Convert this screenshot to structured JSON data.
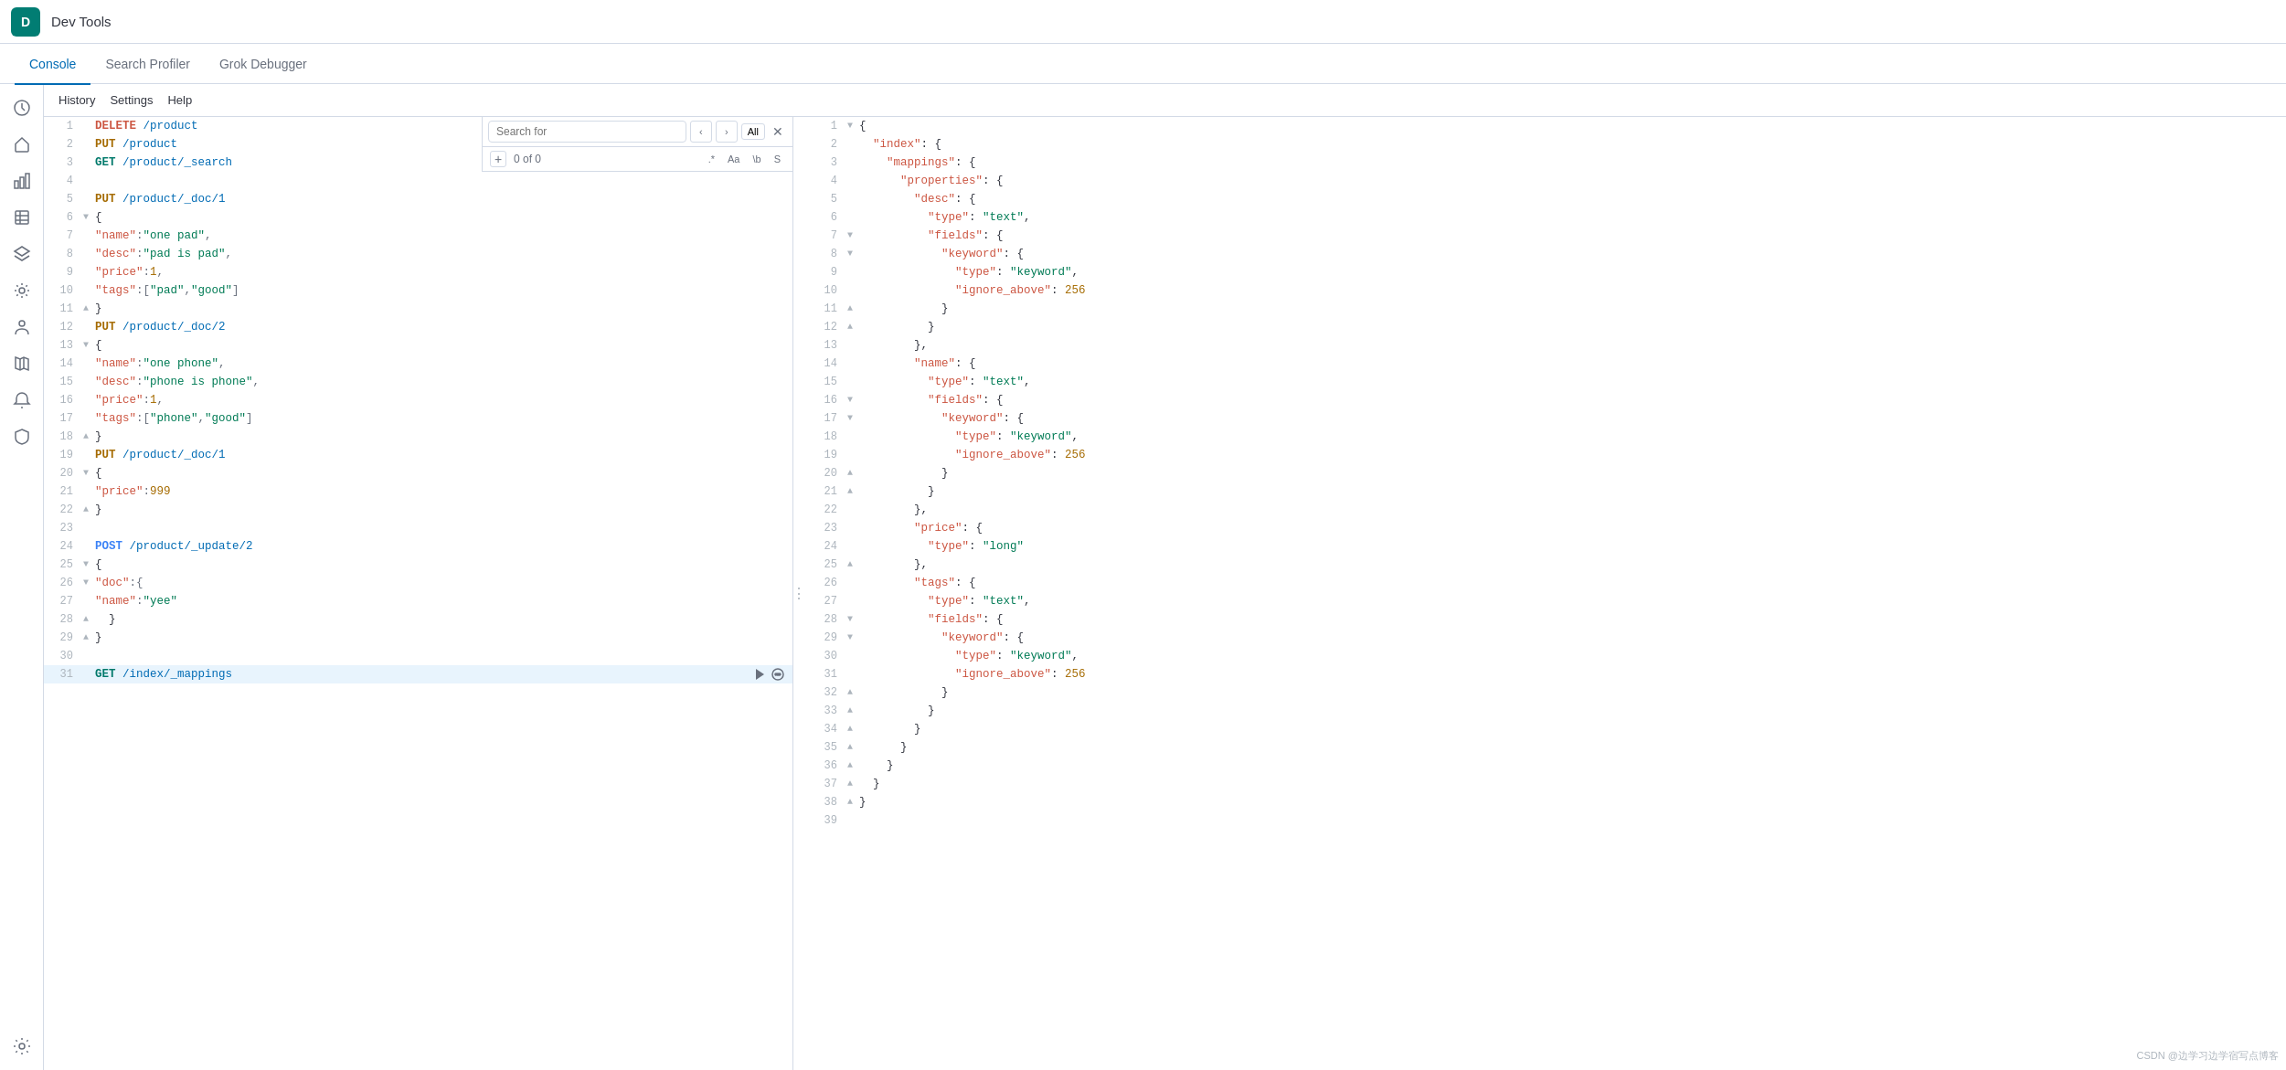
{
  "topbar": {
    "app_icon_label": "D",
    "app_title": "Dev Tools"
  },
  "nav": {
    "tabs": [
      {
        "label": "Console",
        "active": true
      },
      {
        "label": "Search Profiler",
        "active": false
      },
      {
        "label": "Grok Debugger",
        "active": false
      }
    ]
  },
  "subtoolbar": {
    "history_label": "History",
    "settings_label": "Settings",
    "help_label": "Help"
  },
  "search": {
    "placeholder": "Search for",
    "count_text": "0 of 0",
    "all_label": "All",
    "regex_label": ".*",
    "case_label": "Aa",
    "word_label": "\\b",
    "preserve_label": "S"
  },
  "left_editor": {
    "lines": [
      {
        "num": 1,
        "gutter": "",
        "content": "DELETE /product",
        "tokens": [
          {
            "type": "method-delete",
            "text": "DELETE"
          },
          {
            "type": "url",
            "text": " /product"
          }
        ]
      },
      {
        "num": 2,
        "gutter": "",
        "content": "PUT /product",
        "tokens": [
          {
            "type": "method-put",
            "text": "PUT"
          },
          {
            "type": "url",
            "text": " /product"
          }
        ]
      },
      {
        "num": 3,
        "gutter": "",
        "content": "GET /product/_search",
        "tokens": [
          {
            "type": "method-get",
            "text": "GET"
          },
          {
            "type": "url",
            "text": " /product/_search"
          }
        ]
      },
      {
        "num": 4,
        "gutter": "",
        "content": "",
        "tokens": []
      },
      {
        "num": 5,
        "gutter": "",
        "content": "PUT /product/_doc/1",
        "tokens": [
          {
            "type": "method-put",
            "text": "PUT"
          },
          {
            "type": "url",
            "text": " /product/_doc/1"
          }
        ]
      },
      {
        "num": 6,
        "gutter": "▼",
        "content": "{",
        "tokens": [
          {
            "type": "bracket",
            "text": "{"
          }
        ]
      },
      {
        "num": 7,
        "gutter": "",
        "content": "  \"name\":\"one pad\",",
        "tokens": [
          {
            "type": "key",
            "text": "\"name\""
          },
          {
            "type": "punctuation",
            "text": ":"
          },
          {
            "type": "string",
            "text": "\"one pad\""
          },
          {
            "type": "punctuation",
            "text": ","
          }
        ]
      },
      {
        "num": 8,
        "gutter": "",
        "content": "  \"desc\":\"pad is pad\",",
        "tokens": [
          {
            "type": "key",
            "text": "\"desc\""
          },
          {
            "type": "punctuation",
            "text": ":"
          },
          {
            "type": "string",
            "text": "\"pad is pad\""
          },
          {
            "type": "punctuation",
            "text": ","
          }
        ]
      },
      {
        "num": 9,
        "gutter": "",
        "content": "  \"price\":1,",
        "tokens": [
          {
            "type": "key",
            "text": "\"price\""
          },
          {
            "type": "punctuation",
            "text": ":"
          },
          {
            "type": "number",
            "text": "1"
          },
          {
            "type": "punctuation",
            "text": ","
          }
        ]
      },
      {
        "num": 10,
        "gutter": "",
        "content": "  \"tags\":[\"pad\",\"good\"]",
        "tokens": [
          {
            "type": "key",
            "text": "\"tags\""
          },
          {
            "type": "punctuation",
            "text": ":["
          },
          {
            "type": "string",
            "text": "\"pad\""
          },
          {
            "type": "punctuation",
            "text": ","
          },
          {
            "type": "string",
            "text": "\"good\""
          },
          {
            "type": "punctuation",
            "text": "]"
          }
        ]
      },
      {
        "num": 11,
        "gutter": "▲",
        "content": "}",
        "tokens": [
          {
            "type": "bracket",
            "text": "}"
          }
        ]
      },
      {
        "num": 12,
        "gutter": "",
        "content": "PUT /product/_doc/2",
        "tokens": [
          {
            "type": "method-put",
            "text": "PUT"
          },
          {
            "type": "url",
            "text": " /product/_doc/2"
          }
        ]
      },
      {
        "num": 13,
        "gutter": "▼",
        "content": "{",
        "tokens": [
          {
            "type": "bracket",
            "text": "{"
          }
        ]
      },
      {
        "num": 14,
        "gutter": "",
        "content": "  \"name\":\"one phone\",",
        "tokens": [
          {
            "type": "key",
            "text": "\"name\""
          },
          {
            "type": "punctuation",
            "text": ":"
          },
          {
            "type": "string",
            "text": "\"one phone\""
          },
          {
            "type": "punctuation",
            "text": ","
          }
        ]
      },
      {
        "num": 15,
        "gutter": "",
        "content": "  \"desc\":\"phone is phone\",",
        "tokens": [
          {
            "type": "key",
            "text": "\"desc\""
          },
          {
            "type": "punctuation",
            "text": ":"
          },
          {
            "type": "string",
            "text": "\"phone is phone\""
          },
          {
            "type": "punctuation",
            "text": ","
          }
        ]
      },
      {
        "num": 16,
        "gutter": "",
        "content": "  \"price\":1,",
        "tokens": [
          {
            "type": "key",
            "text": "\"price\""
          },
          {
            "type": "punctuation",
            "text": ":"
          },
          {
            "type": "number",
            "text": "1"
          },
          {
            "type": "punctuation",
            "text": ","
          }
        ]
      },
      {
        "num": 17,
        "gutter": "",
        "content": "  \"tags\":[\"phone\",\"good\"]",
        "tokens": [
          {
            "type": "key",
            "text": "\"tags\""
          },
          {
            "type": "punctuation",
            "text": ":["
          },
          {
            "type": "string",
            "text": "\"phone\""
          },
          {
            "type": "punctuation",
            "text": ","
          },
          {
            "type": "string",
            "text": "\"good\""
          },
          {
            "type": "punctuation",
            "text": "]"
          }
        ]
      },
      {
        "num": 18,
        "gutter": "▲",
        "content": "}",
        "tokens": [
          {
            "type": "bracket",
            "text": "}"
          }
        ]
      },
      {
        "num": 19,
        "gutter": "",
        "content": "PUT /product/_doc/1",
        "tokens": [
          {
            "type": "method-put",
            "text": "PUT"
          },
          {
            "type": "url",
            "text": " /product/_doc/1"
          }
        ]
      },
      {
        "num": 20,
        "gutter": "▼",
        "content": "{",
        "tokens": [
          {
            "type": "bracket",
            "text": "{"
          }
        ]
      },
      {
        "num": 21,
        "gutter": "",
        "content": "  \"price\":999",
        "tokens": [
          {
            "type": "key",
            "text": "\"price\""
          },
          {
            "type": "punctuation",
            "text": ":"
          },
          {
            "type": "number",
            "text": "999"
          }
        ]
      },
      {
        "num": 22,
        "gutter": "▲",
        "content": "}",
        "tokens": [
          {
            "type": "bracket",
            "text": "}"
          }
        ]
      },
      {
        "num": 23,
        "gutter": "",
        "content": "",
        "tokens": []
      },
      {
        "num": 24,
        "gutter": "",
        "content": "POST /product/_update/2",
        "tokens": [
          {
            "type": "method-post",
            "text": "POST"
          },
          {
            "type": "url",
            "text": " /product/_update/2"
          }
        ]
      },
      {
        "num": 25,
        "gutter": "▼",
        "content": "{",
        "tokens": [
          {
            "type": "bracket",
            "text": "{"
          }
        ]
      },
      {
        "num": 26,
        "gutter": "▼",
        "content": "  \"doc\":{",
        "tokens": [
          {
            "type": "key",
            "text": "\"doc\""
          },
          {
            "type": "punctuation",
            "text": ":{"
          },
          {
            "type": "bracket",
            "text": ""
          }
        ]
      },
      {
        "num": 27,
        "gutter": "",
        "content": "    \"name\":\"yee\"",
        "tokens": [
          {
            "type": "key",
            "text": "\"name\""
          },
          {
            "type": "punctuation",
            "text": ":"
          },
          {
            "type": "string",
            "text": "\"yee\""
          }
        ]
      },
      {
        "num": 28,
        "gutter": "▲",
        "content": "  }",
        "tokens": [
          {
            "type": "bracket",
            "text": "  }"
          }
        ]
      },
      {
        "num": 29,
        "gutter": "▲",
        "content": "}",
        "tokens": [
          {
            "type": "bracket",
            "text": "}"
          }
        ]
      },
      {
        "num": 30,
        "gutter": "",
        "content": "",
        "tokens": []
      },
      {
        "num": 31,
        "gutter": "",
        "content": "GET /index/_mappings",
        "tokens": [
          {
            "type": "method-get",
            "text": "GET"
          },
          {
            "type": "url",
            "text": " /index/_mappings"
          }
        ],
        "active": true
      }
    ]
  },
  "right_editor": {
    "lines": [
      {
        "num": 1,
        "gutter": "▼",
        "content": "{",
        "type": "bracket"
      },
      {
        "num": 2,
        "gutter": "",
        "content": "  \"index\" : {",
        "indent": 2
      },
      {
        "num": 3,
        "gutter": "",
        "content": "    \"mappings\" : {",
        "indent": 4
      },
      {
        "num": 4,
        "gutter": "",
        "content": "      \"properties\" : {",
        "indent": 6
      },
      {
        "num": 5,
        "gutter": "",
        "content": "        \"desc\" : {",
        "indent": 8
      },
      {
        "num": 6,
        "gutter": "",
        "content": "          \"type\" : \"text\","
      },
      {
        "num": 7,
        "gutter": "▼",
        "content": "          \"fields\" : {"
      },
      {
        "num": 8,
        "gutter": "▼",
        "content": "            \"keyword\" : {"
      },
      {
        "num": 9,
        "gutter": "",
        "content": "              \"type\" : \"keyword\","
      },
      {
        "num": 10,
        "gutter": "",
        "content": "              \"ignore_above\" : 256"
      },
      {
        "num": 11,
        "gutter": "▲",
        "content": "            }"
      },
      {
        "num": 12,
        "gutter": "▲",
        "content": "          }"
      },
      {
        "num": 13,
        "gutter": "",
        "content": "        },"
      },
      {
        "num": 14,
        "gutter": "",
        "content": "        \"name\" : {"
      },
      {
        "num": 15,
        "gutter": "",
        "content": "          \"type\" : \"text\","
      },
      {
        "num": 16,
        "gutter": "▼",
        "content": "          \"fields\" : {"
      },
      {
        "num": 17,
        "gutter": "▼",
        "content": "            \"keyword\" : {"
      },
      {
        "num": 18,
        "gutter": "",
        "content": "              \"type\" : \"keyword\","
      },
      {
        "num": 19,
        "gutter": "",
        "content": "              \"ignore_above\" : 256"
      },
      {
        "num": 20,
        "gutter": "▲",
        "content": "            }"
      },
      {
        "num": 21,
        "gutter": "▲",
        "content": "          }"
      },
      {
        "num": 22,
        "gutter": "",
        "content": "        },"
      },
      {
        "num": 23,
        "gutter": "",
        "content": "        \"price\" : {"
      },
      {
        "num": 24,
        "gutter": "",
        "content": "          \"type\" : \"long\""
      },
      {
        "num": 25,
        "gutter": "▲",
        "content": "        },"
      },
      {
        "num": 26,
        "gutter": "",
        "content": "        \"tags\" : {"
      },
      {
        "num": 27,
        "gutter": "",
        "content": "          \"type\" : \"text\","
      },
      {
        "num": 28,
        "gutter": "▼",
        "content": "          \"fields\" : {"
      },
      {
        "num": 29,
        "gutter": "▼",
        "content": "            \"keyword\" : {"
      },
      {
        "num": 30,
        "gutter": "",
        "content": "              \"type\" : \"keyword\","
      },
      {
        "num": 31,
        "gutter": "",
        "content": "              \"ignore_above\" : 256"
      },
      {
        "num": 32,
        "gutter": "▲",
        "content": "            }"
      },
      {
        "num": 33,
        "gutter": "▲",
        "content": "          }"
      },
      {
        "num": 34,
        "gutter": "▲",
        "content": "        }"
      },
      {
        "num": 35,
        "gutter": "▲",
        "content": "      }"
      },
      {
        "num": 36,
        "gutter": "▲",
        "content": "    }"
      },
      {
        "num": 37,
        "gutter": "▲",
        "content": "  }"
      },
      {
        "num": 38,
        "gutter": "▲",
        "content": "}"
      },
      {
        "num": 39,
        "gutter": "",
        "content": ""
      }
    ]
  },
  "watermark": "CSDN @边学习边学宿写点博客"
}
